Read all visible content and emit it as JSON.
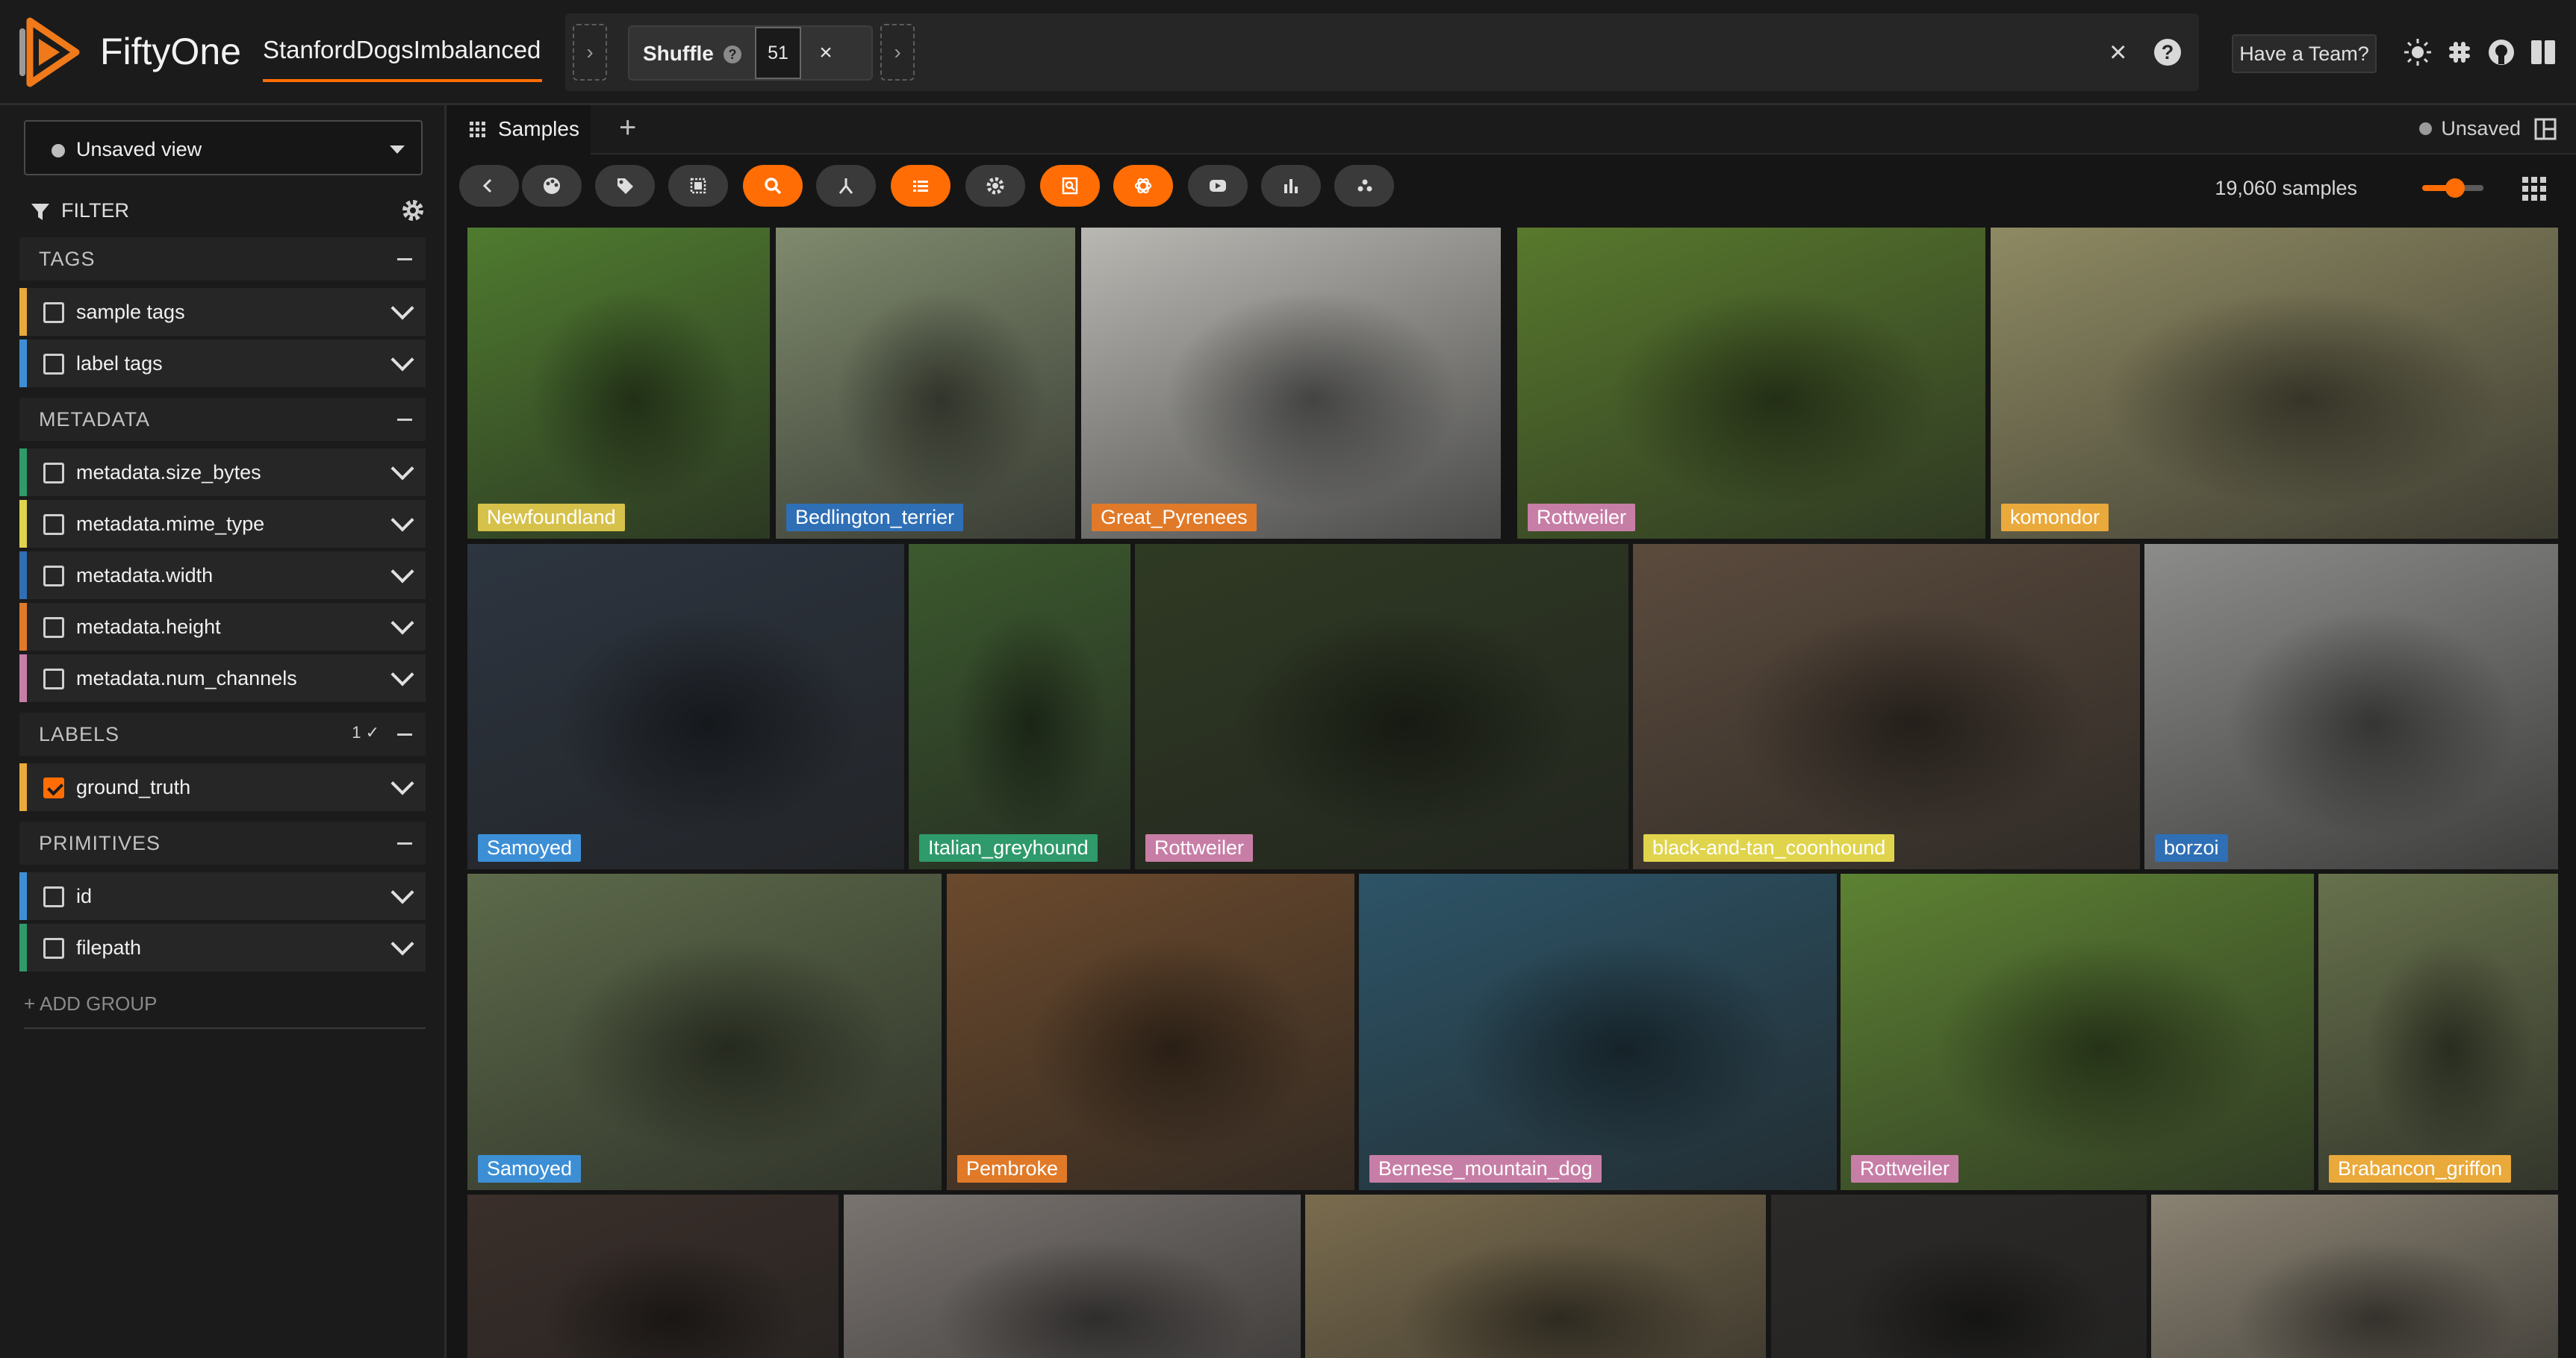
{
  "header": {
    "app_name": "FiftyOne",
    "dataset_name": "StanfordDogsImbalanced",
    "stage_name": "Shuffle",
    "stage_help": "?",
    "stage_param": "51",
    "stage_remove": "×",
    "clear_icon": "×",
    "help_icon": "?",
    "team_button": "Have a Team?",
    "icons": [
      "sun-icon",
      "slack-icon",
      "github-icon",
      "book-icon"
    ]
  },
  "sidebar": {
    "view_select": "Unsaved view",
    "filter_label": "FILTER",
    "groups": [
      {
        "title": "TAGS",
        "fields": [
          {
            "name": "sample tags",
            "color": "#e9a93b",
            "checked": false
          },
          {
            "name": "label tags",
            "color": "#3d8fd5",
            "checked": false
          }
        ]
      },
      {
        "title": "METADATA",
        "fields": [
          {
            "name": "metadata.size_bytes",
            "color": "#2f9a6b",
            "checked": false
          },
          {
            "name": "metadata.mime_type",
            "color": "#e0d44d",
            "checked": false
          },
          {
            "name": "metadata.width",
            "color": "#2f6fb5",
            "checked": false
          },
          {
            "name": "metadata.height",
            "color": "#e07a29",
            "checked": false
          },
          {
            "name": "metadata.num_channels",
            "color": "#c77ea6",
            "checked": false
          }
        ]
      },
      {
        "title": "LABELS",
        "count": "1 ✓",
        "fields": [
          {
            "name": "ground_truth",
            "color": "#e9a93b",
            "checked": true
          }
        ]
      },
      {
        "title": "PRIMITIVES",
        "fields": [
          {
            "name": "id",
            "color": "#3d8fd5",
            "checked": false
          },
          {
            "name": "filepath",
            "color": "#2f9a6b",
            "checked": false
          }
        ]
      }
    ],
    "add_group": "+ ADD GROUP"
  },
  "main": {
    "tab_label": "Samples",
    "tab_add": "+",
    "unsaved_label": "Unsaved",
    "sample_count": "19,060 samples",
    "actions": [
      {
        "icon": "back-icon",
        "on": false
      },
      {
        "icon": "palette-icon",
        "on": false
      },
      {
        "icon": "tag-icon",
        "on": false
      },
      {
        "icon": "patches-icon",
        "on": false
      },
      {
        "icon": "search-icon",
        "on": true
      },
      {
        "icon": "sort-icon",
        "on": false
      },
      {
        "icon": "list-icon",
        "on": true
      },
      {
        "icon": "gear-icon",
        "on": false
      },
      {
        "icon": "browse-icon",
        "on": true
      },
      {
        "icon": "openai-icon",
        "on": true
      },
      {
        "icon": "video-icon",
        "on": false
      },
      {
        "icon": "bar-chart-icon",
        "on": false
      },
      {
        "icon": "embeddings-icon",
        "on": false
      }
    ]
  },
  "grid": {
    "rows": [
      [
        {
          "label": "Newfoundland",
          "color": "#d6c14a",
          "bg": "#4f7b2f"
        },
        {
          "label": "Bedlington_terrier",
          "color": "#2f6fb5",
          "bg": "#7f8a6d"
        },
        {
          "label": "Great_Pyrenees",
          "color": "#e07a29",
          "bg": "#b9b8b3"
        },
        {
          "label": "Rottweiler",
          "color": "#c77ea6",
          "bg": "#58792d"
        },
        {
          "label": "komondor",
          "color": "#e9a93b",
          "bg": "#8e8a63"
        }
      ],
      [
        {
          "label": "Samoyed",
          "color": "#3d8fd5",
          "bg": "#2d3540"
        },
        {
          "label": "Italian_greyhound",
          "color": "#2f9a6b",
          "bg": "#3c5a2e"
        },
        {
          "label": "Rottweiler",
          "color": "#c77ea6",
          "bg": "#2f3a23"
        },
        {
          "label": "black-and-tan_coonhound",
          "color": "#e0d44d",
          "bg": "#5b4b3d"
        },
        {
          "label": "borzoi",
          "color": "#2f6fb5",
          "bg": "#8c8c8a"
        }
      ],
      [
        {
          "label": "Samoyed",
          "color": "#3d8fd5",
          "bg": "#5d6a4a"
        },
        {
          "label": "Pembroke",
          "color": "#e07a29",
          "bg": "#6b4a2d"
        },
        {
          "label": "Bernese_mountain_dog",
          "color": "#c77ea6",
          "bg": "#2d5467"
        },
        {
          "label": "Rottweiler",
          "color": "#c77ea6",
          "bg": "#5d8233"
        },
        {
          "label": "Brabancon_griffon",
          "color": "#e9a93b",
          "bg": "#67714c"
        }
      ],
      [
        {
          "label": "",
          "color": "",
          "bg": "#3a2f2a"
        },
        {
          "label": "",
          "color": "",
          "bg": "#7a7470"
        },
        {
          "label": "",
          "color": "",
          "bg": "#7a6c4e"
        },
        {
          "label": "",
          "color": "",
          "bg": "#2c2a28"
        },
        {
          "label": "",
          "color": "",
          "bg": "#8a8272"
        }
      ]
    ]
  }
}
